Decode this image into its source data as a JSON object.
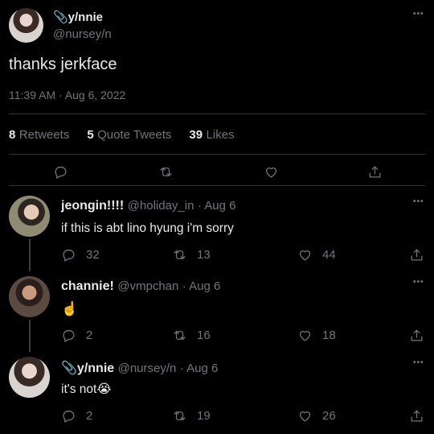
{
  "main_tweet": {
    "display_name": "📎y/nnie",
    "handle": "@nursey/n",
    "text": "thanks jerkface",
    "timestamp": "11:39 AM · Aug 6, 2022",
    "stats": {
      "retweets_count": "8",
      "retweets_label": "Retweets",
      "quotes_count": "5",
      "quotes_label": "Quote Tweets",
      "likes_count": "39",
      "likes_label": "Likes"
    }
  },
  "replies": [
    {
      "display_name": "jeongin!!!!",
      "handle": "@holiday_in",
      "date": "· Aug 6",
      "text": "if this is abt lino hyung i'm sorry",
      "replies": "32",
      "retweets": "13",
      "likes": "44"
    },
    {
      "display_name": "channie!",
      "handle": "@vmpchan",
      "date": "· Aug 6",
      "text": "☝️",
      "replies": "2",
      "retweets": "16",
      "likes": "18"
    },
    {
      "display_name": "📎y/nnie",
      "handle": "@nursey/n",
      "date": "· Aug 6",
      "text": "it's not😭",
      "replies": "2",
      "retweets": "19",
      "likes": "26"
    }
  ],
  "more_label": "•••",
  "colors": {
    "background": "#000000",
    "text": "#e7e9ea",
    "secondary": "#71767b",
    "divider": "#2f3336"
  }
}
